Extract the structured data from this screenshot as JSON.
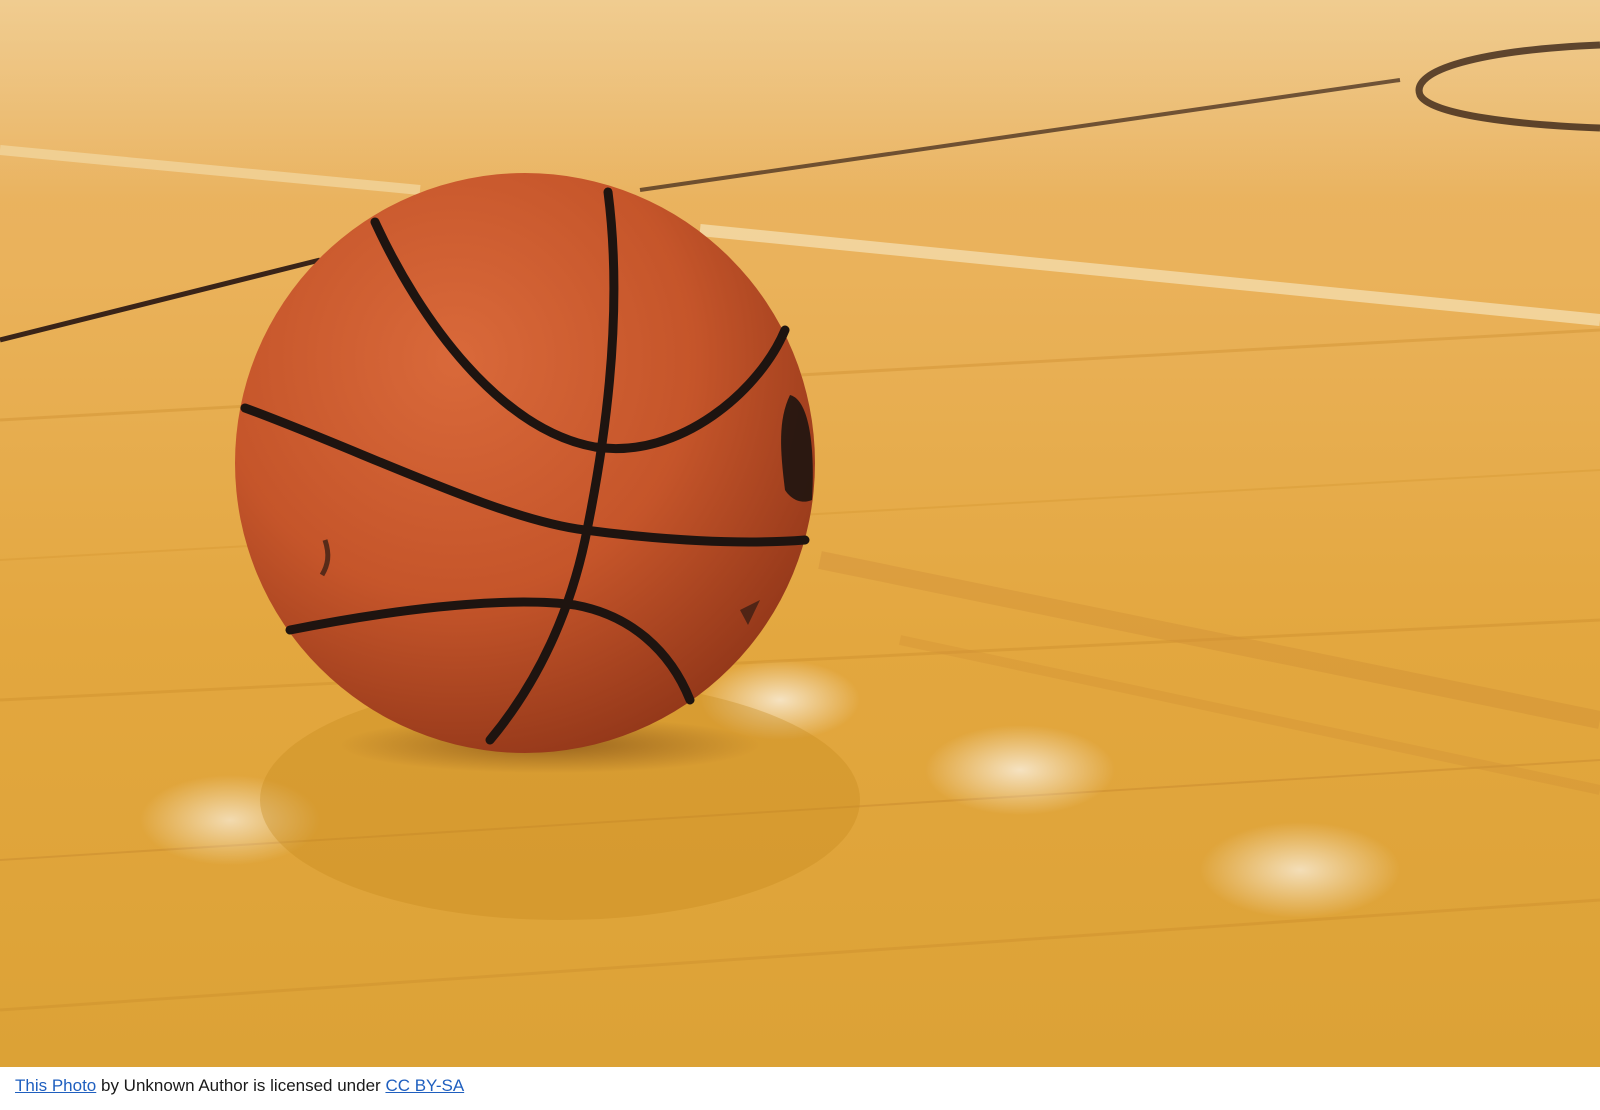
{
  "caption": {
    "photo_link": "This Photo",
    "middle_text": " by Unknown Author is licensed under ",
    "license_link": "CC BY-SA"
  },
  "scene": {
    "subject": "basketball-icon",
    "floor_color": "#e3a73f",
    "ball_color": "#c8582c",
    "seam_color": "#1e1410",
    "link_color": "#1f5fbf"
  }
}
